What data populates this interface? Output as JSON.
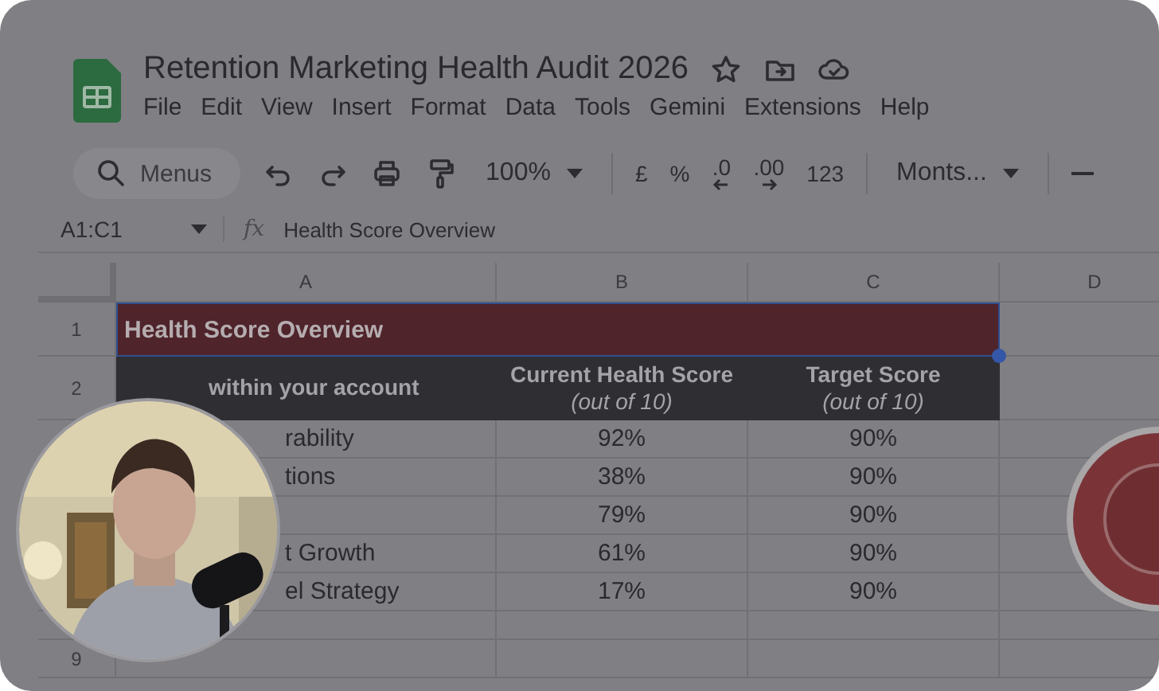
{
  "document": {
    "title": "Retention Marketing Health Audit 2026"
  },
  "menu": [
    "File",
    "Edit",
    "View",
    "Insert",
    "Format",
    "Data",
    "Tools",
    "Gemini",
    "Extensions",
    "Help"
  ],
  "toolbar": [
    {
      "kind": "search",
      "placeholder": "Menus"
    },
    {
      "kind": "undo"
    },
    {
      "kind": "redo"
    },
    {
      "kind": "print"
    },
    {
      "kind": "paint"
    },
    {
      "kind": "dropdown",
      "text": "100%"
    },
    {
      "kind": "divider"
    },
    {
      "kind": "text",
      "text": "£"
    },
    {
      "kind": "text",
      "text": "%"
    },
    {
      "kind": "decimal_less",
      "text": ".0"
    },
    {
      "kind": "decimal_more",
      "text": ".00"
    },
    {
      "kind": "text",
      "text": "123"
    },
    {
      "kind": "divider"
    },
    {
      "kind": "dropdown",
      "text": "Monts..."
    },
    {
      "kind": "divider"
    },
    {
      "kind": "minus"
    }
  ],
  "formula_bar": {
    "name_box": "A1:C1",
    "function_label": "fx",
    "content": "Health Score Overview"
  },
  "columns": [
    "A",
    "B",
    "C",
    "D"
  ],
  "rows": [
    {
      "kind": "title",
      "number": "1",
      "cells": [
        "Health Score Overview"
      ],
      "selected": true
    },
    {
      "kind": "header",
      "number": "2",
      "cells": [
        {
          "label": "within your account"
        },
        {
          "label": "Current Health Score",
          "sub": "(out of 10)"
        },
        {
          "label": "Target Score",
          "sub": "(out of 10)"
        }
      ]
    },
    {
      "kind": "body",
      "cells": [
        "rability",
        "92%",
        "90%"
      ]
    },
    {
      "kind": "body",
      "cells": [
        "tions",
        "38%",
        "90%"
      ]
    },
    {
      "kind": "body",
      "cells": [
        "",
        "79%",
        "90%"
      ]
    },
    {
      "kind": "body",
      "cells": [
        "t Growth",
        "61%",
        "90%"
      ]
    },
    {
      "kind": "body",
      "cells": [
        "el Strategy",
        "17%",
        "90%"
      ]
    },
    {
      "kind": "spacer",
      "cells": []
    },
    {
      "kind": "empty",
      "number": "9",
      "cells": []
    }
  ]
}
